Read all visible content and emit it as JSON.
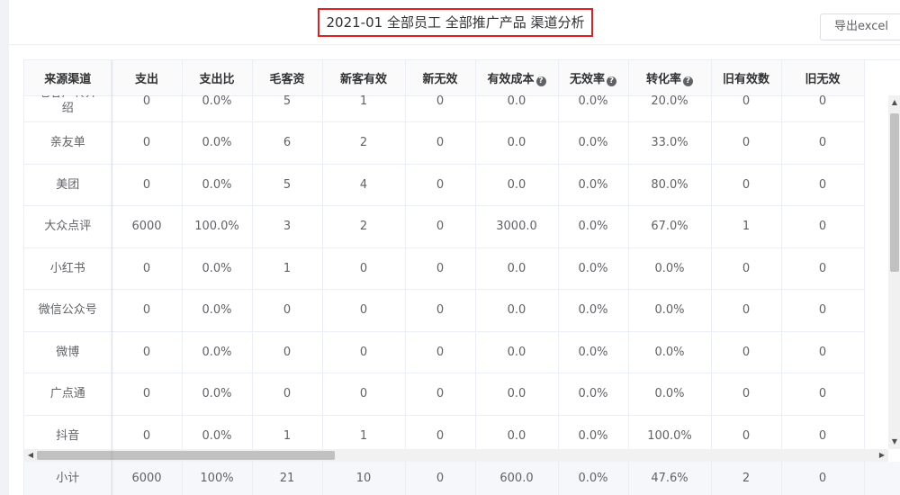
{
  "header": {
    "title": "2021-01 全部员工 全部推广产品 渠道分析",
    "export_label": "导出excel"
  },
  "table": {
    "columns": [
      {
        "label": "来源渠道",
        "help": false
      },
      {
        "label": "支出",
        "help": false
      },
      {
        "label": "支出比",
        "help": false
      },
      {
        "label": "毛客资",
        "help": false
      },
      {
        "label": "新客有效",
        "help": false
      },
      {
        "label": "新无效",
        "help": false
      },
      {
        "label": "有效成本",
        "help": true
      },
      {
        "label": "无效率",
        "help": true
      },
      {
        "label": "转化率",
        "help": true
      },
      {
        "label": "旧有效数",
        "help": false
      },
      {
        "label": "旧无效",
        "help": false
      }
    ],
    "help_glyph": "?",
    "rows": [
      [
        "老客户转介绍",
        "0",
        "0.0%",
        "5",
        "1",
        "0",
        "0.0",
        "0.0%",
        "20.0%",
        "0",
        "0"
      ],
      [
        "亲友单",
        "0",
        "0.0%",
        "6",
        "2",
        "0",
        "0.0",
        "0.0%",
        "33.0%",
        "0",
        "0"
      ],
      [
        "美团",
        "0",
        "0.0%",
        "5",
        "4",
        "0",
        "0.0",
        "0.0%",
        "80.0%",
        "0",
        "0"
      ],
      [
        "大众点评",
        "6000",
        "100.0%",
        "3",
        "2",
        "0",
        "3000.0",
        "0.0%",
        "67.0%",
        "1",
        "0"
      ],
      [
        "小红书",
        "0",
        "0.0%",
        "1",
        "0",
        "0",
        "0.0",
        "0.0%",
        "0.0%",
        "0",
        "0"
      ],
      [
        "微信公众号",
        "0",
        "0.0%",
        "0",
        "0",
        "0",
        "0.0",
        "0.0%",
        "0.0%",
        "0",
        "0"
      ],
      [
        "微博",
        "0",
        "0.0%",
        "0",
        "0",
        "0",
        "0.0",
        "0.0%",
        "0.0%",
        "0",
        "0"
      ],
      [
        "广点通",
        "0",
        "0.0%",
        "0",
        "0",
        "0",
        "0.0",
        "0.0%",
        "0.0%",
        "0",
        "0"
      ],
      [
        "抖音",
        "0",
        "0.0%",
        "1",
        "1",
        "0",
        "0.0",
        "0.0%",
        "100.0%",
        "0",
        "0"
      ]
    ],
    "summary": [
      "小计",
      "6000",
      "100%",
      "21",
      "10",
      "0",
      "600.0",
      "0.0%",
      "47.6%",
      "2",
      "0"
    ]
  },
  "scrollbars": {
    "vertical_position": 0.1,
    "horizontal_position": 0.0,
    "up_arrow": "▲",
    "down_arrow": "▼",
    "left_arrow": "◀",
    "right_arrow": "▶"
  },
  "colors": {
    "title_highlight": "#e02020",
    "border": "#ebeef5",
    "header_text": "#303133",
    "cell_text": "#606266"
  }
}
